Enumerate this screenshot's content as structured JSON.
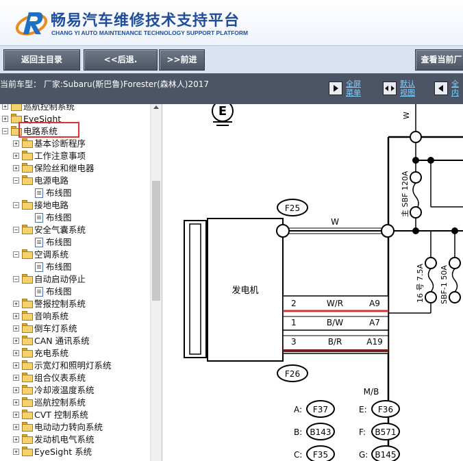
{
  "header": {
    "title": "畅易汽车维修技术支持平台",
    "subtitle": "CHANG YI AUTO MAINTENANCE TECHNOLOGY SUPPORT PLATFORM"
  },
  "nav": {
    "home_label": "返回主目录",
    "back_label": "<<后退.",
    "forward_label": ">>前进",
    "view_label": "查看当前厂"
  },
  "info": {
    "car": "当前车型：  厂家:Subaru(斯巴鲁)Forester(森林人)2017",
    "tools": [
      {
        "label": "全屏\n菜单",
        "icon": "play-icon"
      },
      {
        "label": "默认\n视图",
        "icon": "expand-icon"
      },
      {
        "label": "全\n内",
        "icon": "play-left-icon"
      }
    ]
  },
  "tree": {
    "items": [
      {
        "label": "巡航控制系统",
        "level": 0,
        "type": "folder",
        "state": "+"
      },
      {
        "label": "EyeSight",
        "level": 0,
        "type": "folder",
        "state": "+"
      },
      {
        "label": "电路系统",
        "level": 0,
        "type": "folder",
        "state": "-"
      },
      {
        "label": "基本诊断程序",
        "level": 1,
        "type": "folder",
        "state": "+"
      },
      {
        "label": "工作注意事项",
        "level": 1,
        "type": "folder",
        "state": "+"
      },
      {
        "label": "保险丝和继电器",
        "level": 1,
        "type": "folder",
        "state": "+"
      },
      {
        "label": "电源电路",
        "level": 1,
        "type": "folder",
        "state": "-"
      },
      {
        "label": "布线图",
        "level": 2,
        "type": "doc",
        "state": ""
      },
      {
        "label": "接地电路",
        "level": 1,
        "type": "folder",
        "state": "-"
      },
      {
        "label": "布线图",
        "level": 2,
        "type": "doc",
        "state": ""
      },
      {
        "label": "安全气囊系统",
        "level": 1,
        "type": "folder",
        "state": "-"
      },
      {
        "label": "布线图",
        "level": 2,
        "type": "doc",
        "state": ""
      },
      {
        "label": "空调系统",
        "level": 1,
        "type": "folder",
        "state": "-"
      },
      {
        "label": "布线图",
        "level": 2,
        "type": "doc",
        "state": ""
      },
      {
        "label": "自动启动停止",
        "level": 1,
        "type": "folder",
        "state": "-"
      },
      {
        "label": "布线图",
        "level": 2,
        "type": "doc",
        "state": ""
      },
      {
        "label": "警报控制系统",
        "level": 1,
        "type": "folder",
        "state": "+"
      },
      {
        "label": "音响系统",
        "level": 1,
        "type": "folder",
        "state": "+"
      },
      {
        "label": "倒车灯系统",
        "level": 1,
        "type": "folder",
        "state": "+"
      },
      {
        "label": "CAN 通讯系统",
        "level": 1,
        "type": "folder",
        "state": "+"
      },
      {
        "label": "充电系统",
        "level": 1,
        "type": "folder",
        "state": "+"
      },
      {
        "label": "示宽灯和照明灯系统",
        "level": 1,
        "type": "folder",
        "state": "+"
      },
      {
        "label": "组合仪表系统",
        "level": 1,
        "type": "folder",
        "state": "+"
      },
      {
        "label": "冷却液温度系统",
        "level": 1,
        "type": "folder",
        "state": "+"
      },
      {
        "label": "巡航控制系统",
        "level": 1,
        "type": "folder",
        "state": "+"
      },
      {
        "label": "CVT 控制系统",
        "level": 1,
        "type": "folder",
        "state": "+"
      },
      {
        "label": "电动动力转向系统",
        "level": 1,
        "type": "folder",
        "state": "+"
      },
      {
        "label": "发动机电气系统",
        "level": 1,
        "type": "folder",
        "state": "+"
      },
      {
        "label": "EyeSight 系统",
        "level": 1,
        "type": "folder",
        "state": "+"
      }
    ]
  },
  "diagram": {
    "ground_label": "E",
    "alternator_label": "发电机",
    "connector_f25": "F25",
    "connector_f26": "F26",
    "wire_w_top": "W",
    "wire_w_mid": "W",
    "fuse_main_label": "主 SBF 120A",
    "fuse_16_label": "16 号 7.5A",
    "fuse_sbf1_label": "SBF-1 50A",
    "pins": [
      {
        "num": "2",
        "color": "W/R",
        "term": "A9"
      },
      {
        "num": "1",
        "color": "B/W",
        "term": "A7"
      },
      {
        "num": "3",
        "color": "B/R",
        "term": "A19"
      }
    ],
    "mb_label": "M/B",
    "refs": [
      {
        "key": "A:",
        "value": "F37"
      },
      {
        "key": "E:",
        "value": "F36"
      },
      {
        "key": "B:",
        "value": "B143"
      },
      {
        "key": "F:",
        "value": "B571"
      },
      {
        "key": "C:",
        "value": "F35"
      },
      {
        "key": "G:",
        "value": "B145"
      }
    ]
  }
}
